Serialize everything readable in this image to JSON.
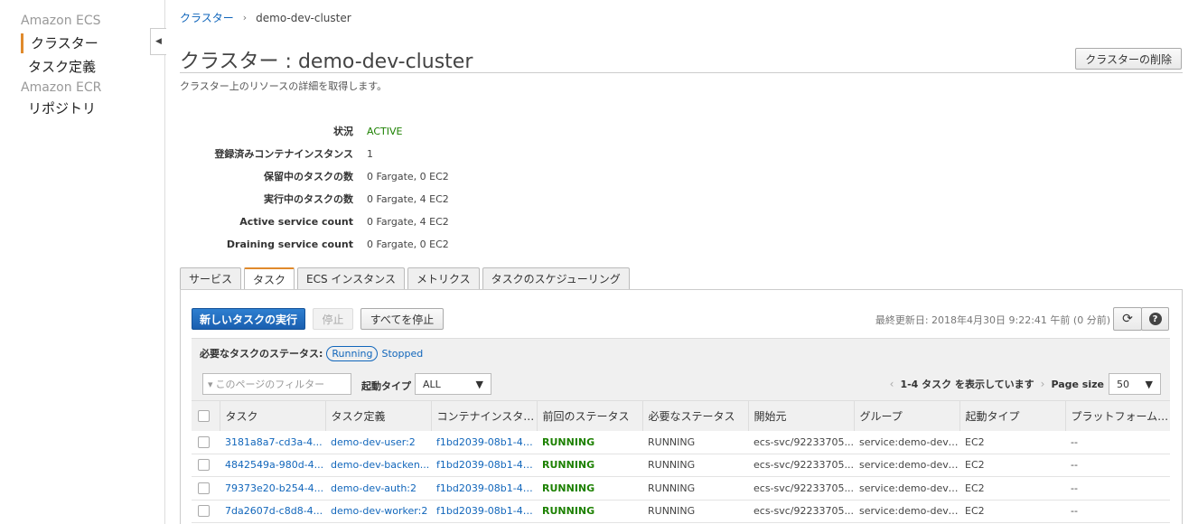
{
  "sidebar": {
    "groups": [
      {
        "title": "Amazon ECS",
        "items": [
          "クラスター",
          "タスク定義"
        ]
      },
      {
        "title": "Amazon ECR",
        "items": [
          "リポジトリ"
        ]
      }
    ],
    "collapse_icon": "chevron-left-icon"
  },
  "breadcrumb": {
    "root": "クラスター",
    "current": "demo-dev-cluster"
  },
  "page": {
    "title": "クラスター : demo-dev-cluster",
    "subtitle": "クラスター上のリソースの詳細を取得します。",
    "delete_label": "クラスターの削除"
  },
  "details": [
    {
      "label": "状況",
      "value": "ACTIVE",
      "color": "#1d8102"
    },
    {
      "label": "登録済みコンテナインスタンス",
      "value": "1"
    },
    {
      "label": "保留中のタスクの数",
      "value": "0 Fargate, 0 EC2"
    },
    {
      "label": "実行中のタスクの数",
      "value": "0 Fargate, 4 EC2"
    },
    {
      "label": "Active service count",
      "value": "0 Fargate, 4 EC2"
    },
    {
      "label": "Draining service count",
      "value": "0 Fargate, 0 EC2"
    }
  ],
  "tabs": [
    "サービス",
    "タスク",
    "ECS インスタンス",
    "メトリクス",
    "タスクのスケジューリング"
  ],
  "active_tab": "タスク",
  "toolbar": {
    "run_label": "新しいタスクの実行",
    "stop_label": "停止",
    "stop_all_label": "すべてを停止",
    "last_updated": "最終更新日: 2018年4月30日 9:22:41 午前 (0 分前)",
    "refresh_icon": "refresh-icon",
    "help_icon": "help-icon",
    "help_glyph": "?"
  },
  "status_filter": {
    "label": "必要なタスクのステータス:",
    "running": "Running",
    "stopped": "Stopped"
  },
  "filter": {
    "placeholder": "このページのフィルター",
    "launch_type_label": "起動タイプ",
    "launch_type_value": "ALL",
    "showing": "1-4 タスク を表示しています",
    "page_size_label": "Page size",
    "page_size_value": "50"
  },
  "table": {
    "columns": [
      "タスク",
      "タスク定義",
      "コンテナインスタ…",
      "前回のステータス",
      "必要なステータス",
      "開始元",
      "グループ",
      "起動タイプ",
      "プラットフォーム…"
    ],
    "rows": [
      [
        "3181a8a7-cd3a-4...",
        "demo-dev-user:2",
        "f1bd2039-08b1-40...",
        "RUNNING",
        "RUNNING",
        "ecs-svc/92233705...",
        "service:demo-dev-...",
        "EC2",
        "--"
      ],
      [
        "4842549a-980d-4...",
        "demo-dev-backen...",
        "f1bd2039-08b1-40...",
        "RUNNING",
        "RUNNING",
        "ecs-svc/92233705...",
        "service:demo-dev-...",
        "EC2",
        "--"
      ],
      [
        "79373e20-b254-4...",
        "demo-dev-auth:2",
        "f1bd2039-08b1-40...",
        "RUNNING",
        "RUNNING",
        "ecs-svc/92233705...",
        "service:demo-dev-...",
        "EC2",
        "--"
      ],
      [
        "7da2607d-c8d8-4...",
        "demo-dev-worker:2",
        "f1bd2039-08b1-40...",
        "RUNNING",
        "RUNNING",
        "ecs-svc/92233705...",
        "service:demo-dev-...",
        "EC2",
        "--"
      ]
    ]
  }
}
